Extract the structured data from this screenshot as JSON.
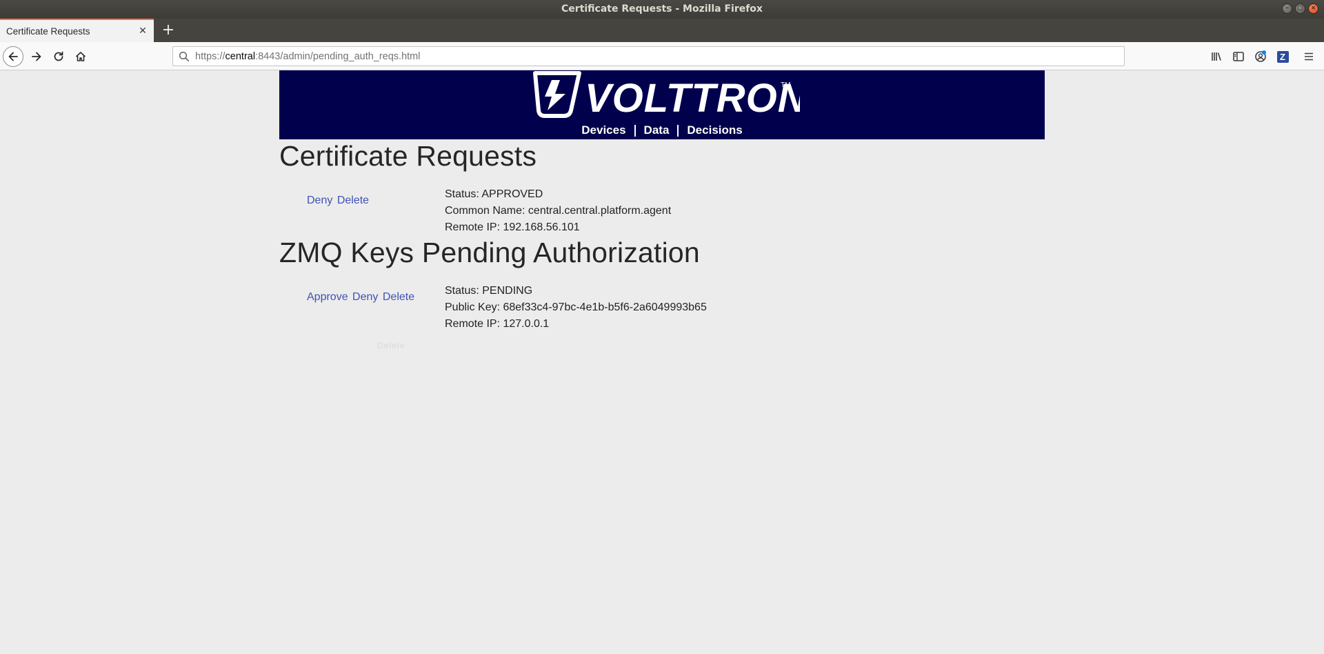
{
  "window": {
    "title": "Certificate Requests - Mozilla Firefox"
  },
  "tabs": [
    {
      "label": "Certificate Requests",
      "active": true
    }
  ],
  "urlbar": {
    "scheme": "https://",
    "host": "central",
    "rest": ":8443/admin/pending_auth_reqs.html"
  },
  "toolbar_icons": [
    "library-icon",
    "sidebar-icon",
    "account-icon",
    "zotero-icon",
    "menu-icon"
  ],
  "zotero_letter": "Z",
  "banner": {
    "logo_text": "VOLTTRON",
    "trademark": "TM",
    "nav": [
      "Devices",
      "Data",
      "Decisions"
    ],
    "background": "#00004d"
  },
  "certificate_section": {
    "heading": "Certificate Requests",
    "actions": [
      "Deny",
      "Delete"
    ],
    "status": "Status: APPROVED",
    "common_name": "Common Name: central.central.platform.agent",
    "remote_ip": "Remote IP: 192.168.56.101"
  },
  "zmq_section": {
    "heading": "ZMQ Keys Pending Authorization",
    "actions": [
      "Approve",
      "Deny",
      "Delete"
    ],
    "status": "Status: PENDING",
    "public_key": "Public Key: 68ef33c4-97bc-4e1b-b5f6-2a6049993b65",
    "remote_ip": "Remote IP: 127.0.0.1"
  },
  "faded_actions": "Delete",
  "colors": {
    "link": "#3f51b5",
    "tab_accent": "#ff7139"
  }
}
